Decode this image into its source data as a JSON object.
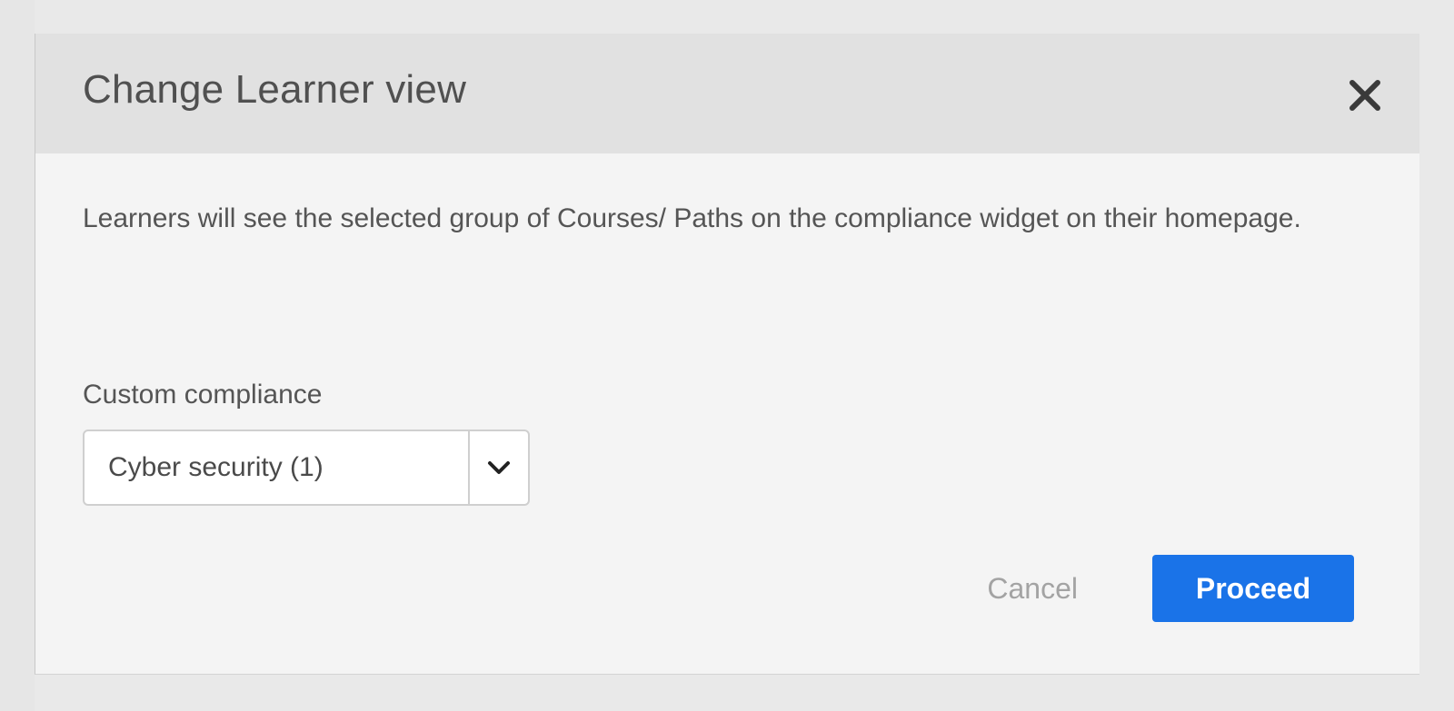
{
  "dialog": {
    "title": "Change Learner view",
    "close_icon": "close-icon",
    "description": "Learners will see the selected group of Courses/ Paths on the compliance widget on their homepage.",
    "field": {
      "label": "Custom compliance",
      "selected_value": "Cyber security (1)",
      "toggle_icon": "chevron-down-icon"
    },
    "actions": {
      "cancel_label": "Cancel",
      "proceed_label": "Proceed"
    }
  },
  "colors": {
    "backdrop": "#e9e9e9",
    "header": "#e1e1e1",
    "body": "#f4f4f4",
    "primary": "#1a73e8",
    "title_text": "#505050",
    "muted_text": "#a3a3a3"
  }
}
